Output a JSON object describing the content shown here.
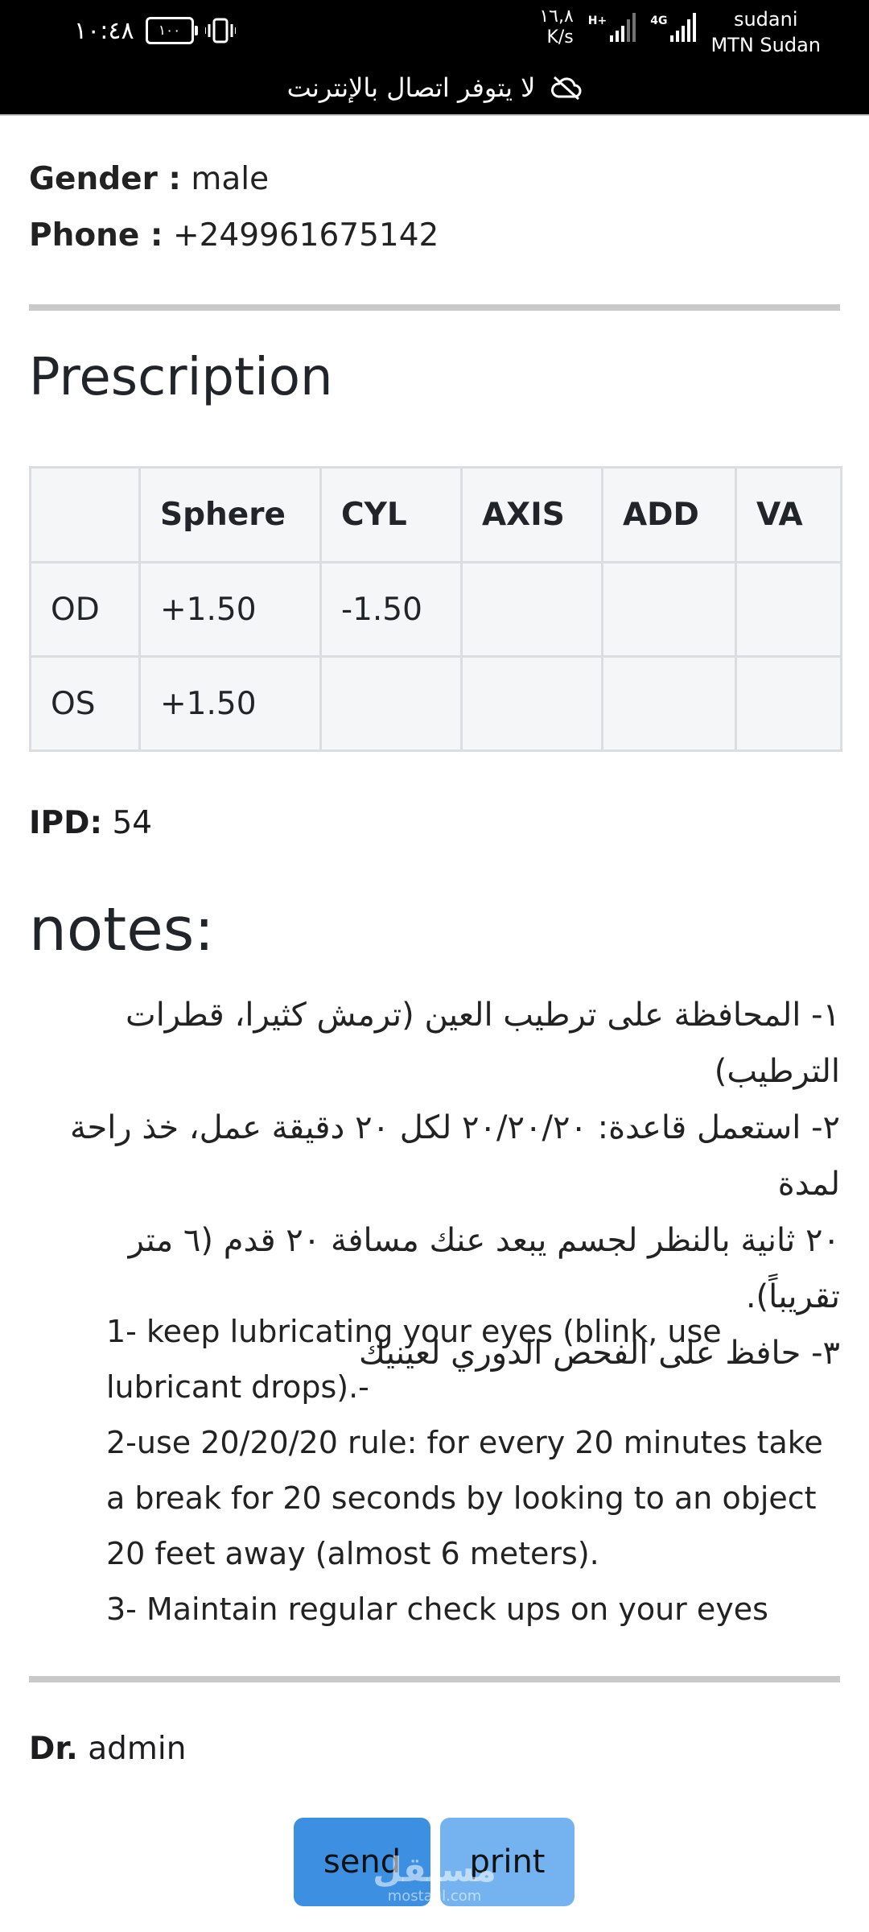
{
  "status_bar": {
    "time": "١٠:٤٨",
    "battery": "١٠٠",
    "net_speed_value": "١٦,٨",
    "net_speed_unit": "K/s",
    "sim1_tag": "H+",
    "sim2_tag": "4G",
    "carrier_line1": "sudani",
    "carrier_line2": "MTN Sudan",
    "offline_message": "لا يتوفر اتصال بالإنترنت"
  },
  "patient": {
    "gender_label": "Gender :",
    "gender_value": "male",
    "phone_label": "Phone :",
    "phone_value": "+249961675142"
  },
  "prescription": {
    "title": "Prescription",
    "headers": [
      "",
      "Sphere",
      "CYL",
      "AXIS",
      "ADD",
      "VA"
    ],
    "rows": [
      [
        "OD",
        "+1.50",
        "-1.50",
        "",
        "",
        ""
      ],
      [
        "OS",
        "+1.50",
        "",
        "",
        "",
        ""
      ]
    ],
    "ipd_label": "IPD:",
    "ipd_value": "54"
  },
  "notes": {
    "title": "notes:",
    "arabic_lines": [
      "١- المحافظة على ترطيب العين (ترمش كثيرا، قطرات",
      "الترطيب)",
      "٢- استعمل قاعدة: ٢٠/٢٠/٢٠ لكل ٢٠ دقيقة عمل، خذ راحة لمدة",
      "٢٠ ثانية بالنظر لجسم يبعد عنك مسافة ٢٠ قدم (٦ متر تقريباً).",
      "٣- حافظ على الفحص الدوري لعينيك"
    ],
    "english_lines": [
      "1- keep lubricating your eyes (blink, use",
      "lubricant drops).-",
      "2-use 20/20/20 rule: for every 20 minutes take",
      "a break for 20 seconds by looking to an object",
      "20 feet away (almost 6 meters).",
      "3- Maintain regular check ups on your eyes"
    ]
  },
  "doctor": {
    "label": "Dr.",
    "name": "admin"
  },
  "actions": {
    "send_label": "send",
    "print_label": "print"
  },
  "watermark": {
    "arabic": "مستقل",
    "latin": "mostaql.com"
  },
  "colors": {
    "send_button": "#3d8fe2",
    "print_button": "#74b3f0",
    "divider": "#c9c9c9",
    "table_bg": "#f5f6f8"
  }
}
